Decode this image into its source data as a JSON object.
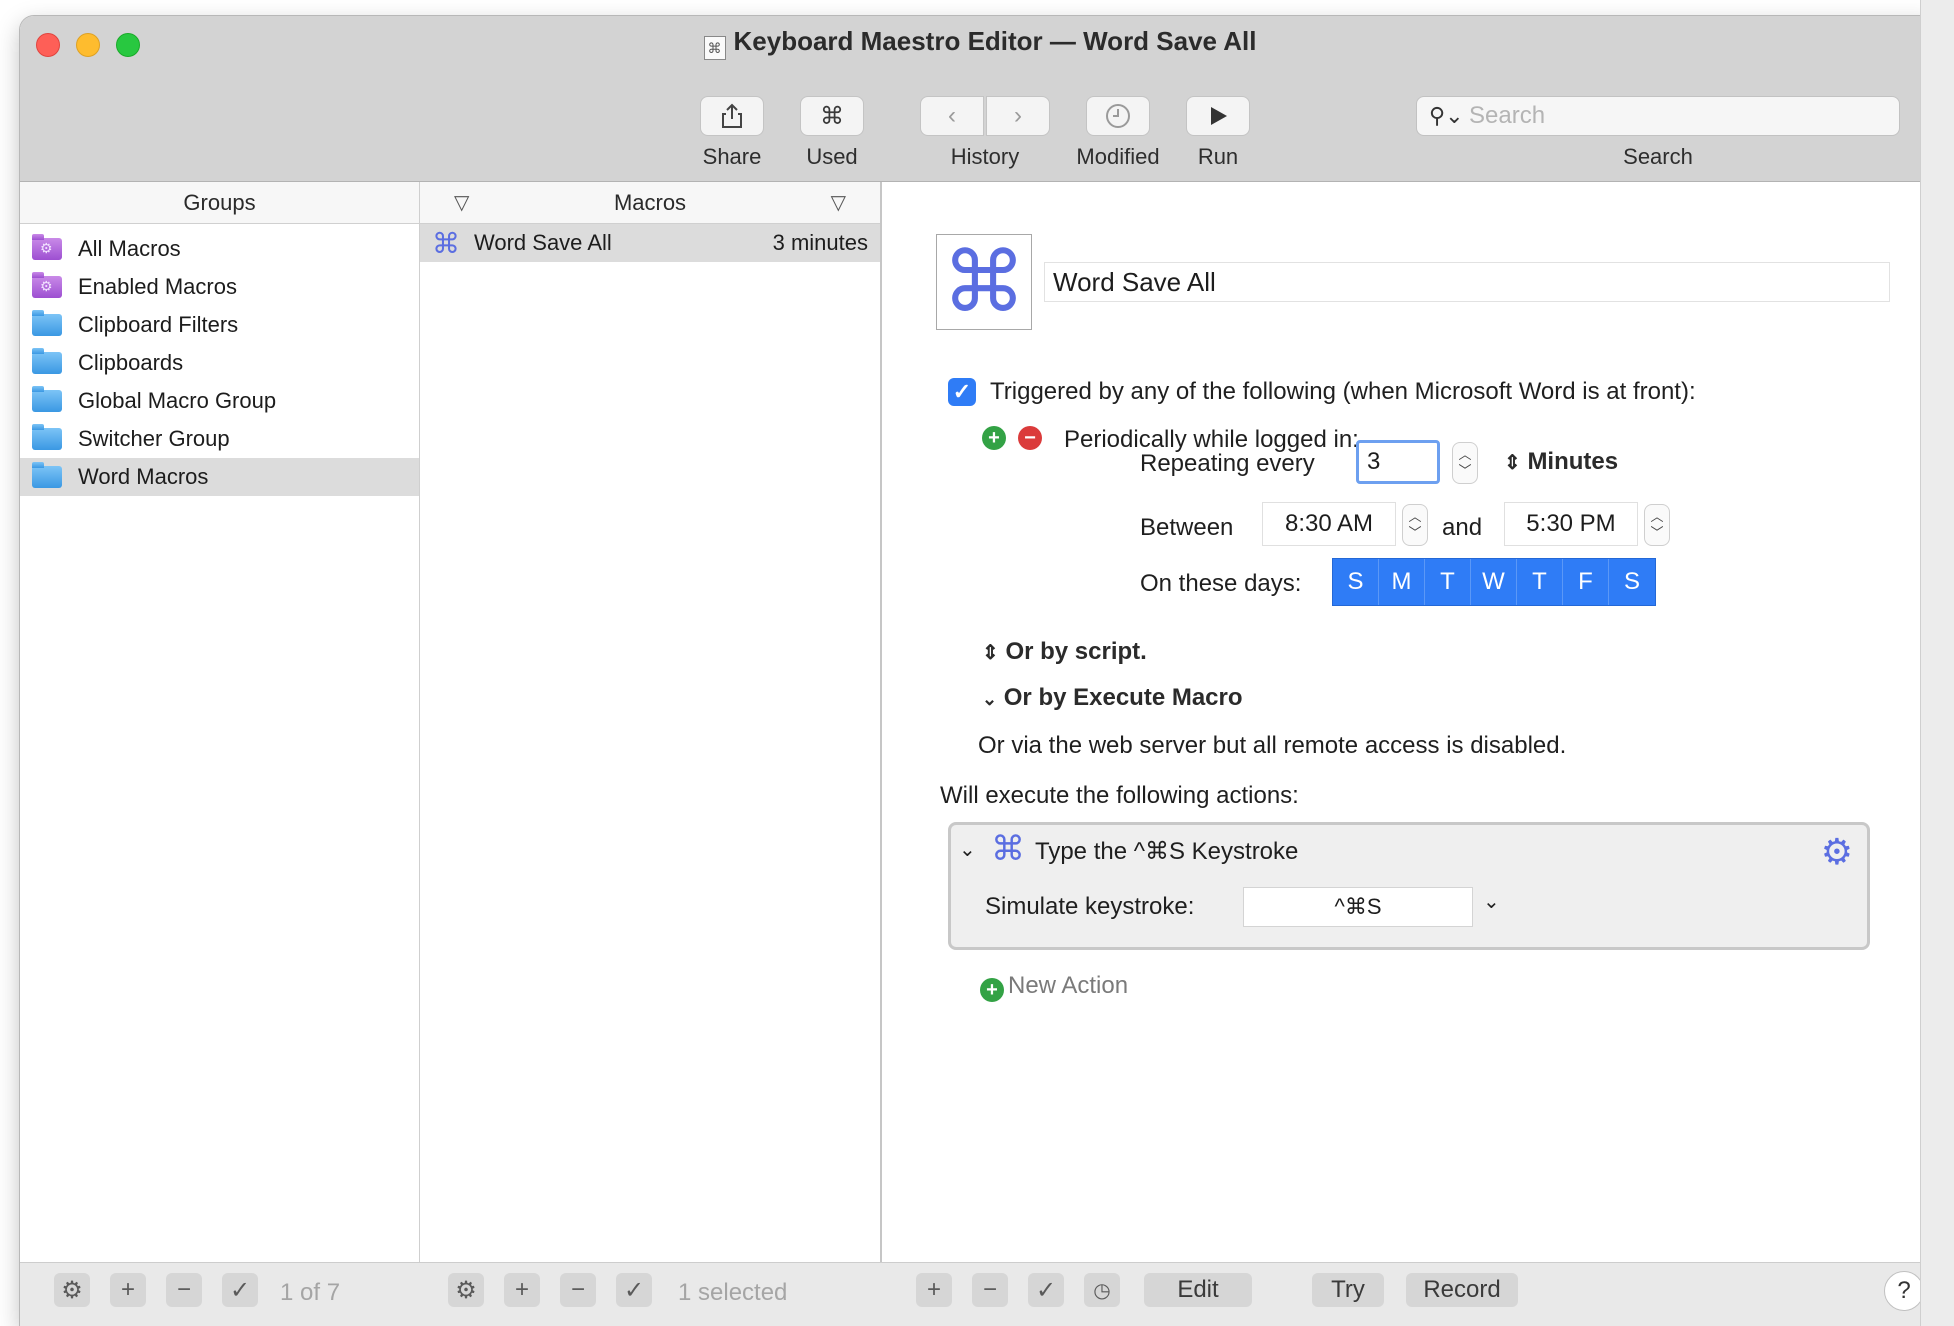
{
  "window": {
    "title": "Keyboard Maestro Editor — Word Save All",
    "doc_icon_glyph": "⌘"
  },
  "toolbar": {
    "share_label": "Share",
    "used_label": "Used",
    "history_label": "History",
    "modified_label": "Modified",
    "run_label": "Run",
    "search_label": "Search",
    "search_placeholder": "Search"
  },
  "groups": {
    "header": "Groups",
    "items": [
      {
        "label": "All Macros",
        "color": "purple",
        "icon": "smart-group-icon"
      },
      {
        "label": "Enabled Macros",
        "color": "purple",
        "icon": "smart-group-icon"
      },
      {
        "label": "Clipboard Filters",
        "color": "blue",
        "icon": "folder-icon"
      },
      {
        "label": "Clipboards",
        "color": "blue",
        "icon": "folder-icon"
      },
      {
        "label": "Global Macro Group",
        "color": "blue",
        "icon": "folder-icon"
      },
      {
        "label": "Switcher Group",
        "color": "blue",
        "icon": "folder-icon"
      },
      {
        "label": "Word Macros",
        "color": "blue",
        "icon": "folder-icon",
        "selected": true
      }
    ],
    "footer_count": "1 of 7"
  },
  "macros": {
    "header": "Macros",
    "items": [
      {
        "name": "Word Save All",
        "time": "3 minutes",
        "icon": "command-icon"
      }
    ],
    "footer_count": "1 selected"
  },
  "editor": {
    "macro_name": "Word Save All",
    "trigger_heading": "Triggered by any of the following (when Microsoft Word is at front):",
    "trigger_type": "Periodically while logged in:",
    "repeating_label": "Repeating every",
    "repeating_value": "3",
    "unit": "Minutes",
    "between_label": "Between",
    "start_time": "8:30 AM",
    "and_label": "and",
    "end_time": "5:30 PM",
    "days_label": "On these days:",
    "days": [
      "S",
      "M",
      "T",
      "W",
      "T",
      "F",
      "S"
    ],
    "or_script": "Or by script.",
    "or_execute": "Or by Execute Macro",
    "web_server_note": "Or via the web server but all remote access is disabled.",
    "will_execute": "Will execute the following actions:",
    "action_title": "Type the ^⌘S Keystroke",
    "simulate_label": "Simulate keystroke:",
    "keystroke": "^⌘S",
    "new_action": "New Action"
  },
  "bottombar": {
    "edit_label": "Edit",
    "try_label": "Try",
    "record_label": "Record",
    "help_label": "?"
  },
  "colors": {
    "accent": "#2f7cf6",
    "macro_icon": "#5b6ee1",
    "folder_blue": "#3a98e3",
    "folder_purple": "#9d4fd1"
  }
}
